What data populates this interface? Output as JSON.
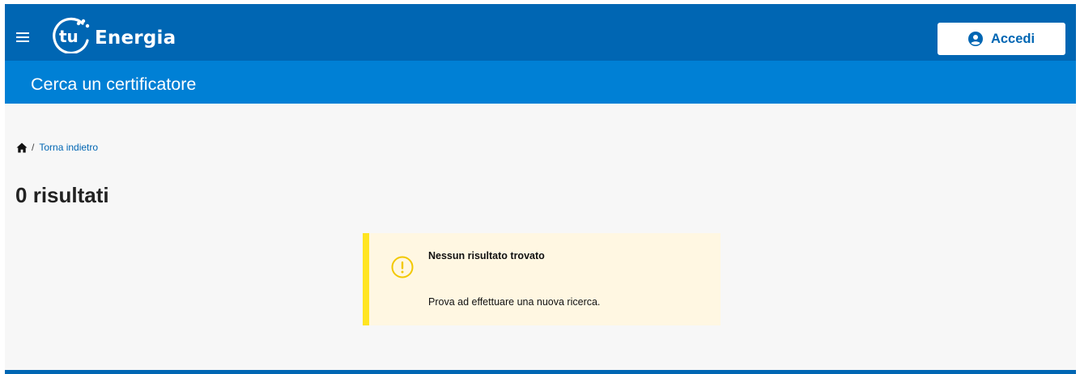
{
  "header": {
    "logo_text": "tu",
    "brand": "Energia",
    "login_label": "Accedi",
    "menu_icon": "hamburger-menu-icon",
    "user_icon": "user-circle-icon"
  },
  "subheader": {
    "title": "Cerca un certificatore"
  },
  "breadcrumb": {
    "home_icon": "home-icon",
    "separator": "/",
    "back_label": "Torna indietro"
  },
  "results": {
    "count": "0",
    "label": "risultati"
  },
  "alert": {
    "icon": "warning-circle-icon",
    "title": "Nessun risultato trovato",
    "message": "Prova ad effettuare una nuova ricerca."
  },
  "colors": {
    "primary": "#0066b3",
    "secondary": "#0080d5",
    "alert_background": "#fff7e2",
    "alert_accent": "#ffe521"
  }
}
